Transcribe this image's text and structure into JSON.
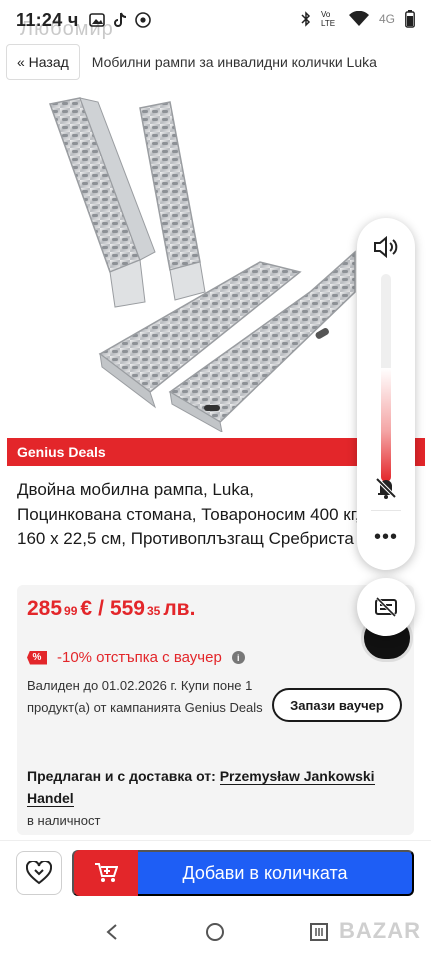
{
  "status_bar": {
    "time": "11:24 ч",
    "network": "4G",
    "volte": "Vo LTE"
  },
  "background_username": "Любомир",
  "nav": {
    "back_label": "« Назад",
    "title": "Мобилни рампи за инвалидни колички Luka"
  },
  "image": {
    "alt_icon": "product-photo-icon"
  },
  "genius_label": "Genius Deals",
  "product_title": "Двойна мобилна рампа, Luka, Поцинкована стомана, Товароносим 400 кг, 160 х 22,5 см, Противоплъзгащ Сребриста",
  "price": {
    "eur_main": "285",
    "eur_cents": "99",
    "eur_currency": "€",
    "separator": "/",
    "bgn_main": "559",
    "bgn_cents": "35",
    "bgn_currency": "лв."
  },
  "voucher": {
    "badge": "%",
    "text": "-10% отстъпка с ваучер",
    "info": "i",
    "valid_text": "Валиден до 01.02.2026 г. Купи поне 1 продукт(а) от кампанията Genius Deals",
    "save_button": "Запази ваучер"
  },
  "seller": {
    "prefix": "Предлаган и с доставка от: ",
    "name": "Przemysław Jankowski Handel",
    "stock": "в наличност"
  },
  "bottom": {
    "add_to_cart": "Добави в количката"
  },
  "volume": {
    "level_percent": 55,
    "more": "•••"
  },
  "watermark": "BAZAR",
  "colors": {
    "brand_red": "#e3262a",
    "brand_blue": "#1e5ef5"
  }
}
